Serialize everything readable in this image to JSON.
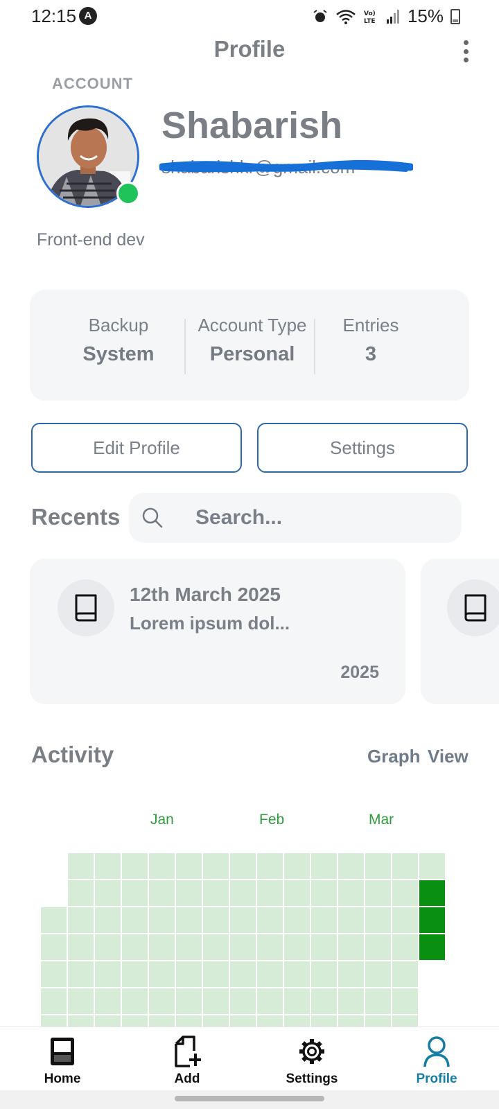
{
  "status_bar": {
    "time": "12:15",
    "app_icon": "A",
    "battery": "15%"
  },
  "header": {
    "title": "Profile",
    "menu_icon": "kebab-menu-icon"
  },
  "account": {
    "section_label": "ACCOUNT",
    "name": "Shabarish",
    "email": "shabarishkr@gmail.com",
    "email_redacted": true,
    "role": "Front-end  dev",
    "online": true
  },
  "stats": [
    {
      "label": "Backup",
      "value": "System"
    },
    {
      "label": "Account Type",
      "value": "Personal"
    },
    {
      "label": "Entries",
      "value": "3"
    }
  ],
  "actions": {
    "edit_profile": "Edit Profile",
    "settings": "Settings"
  },
  "recents": {
    "title": "Recents",
    "search_placeholder": "Search...",
    "items": [
      {
        "date": "12th March 2025",
        "snippet": "Lorem ipsum dol...",
        "year": "2025",
        "icon": "book-icon"
      },
      {
        "date": "",
        "snippet": "",
        "year": "",
        "icon": "book-icon"
      }
    ]
  },
  "activity": {
    "title": "Activity",
    "graph_label": "Graph",
    "view_label": "View",
    "months": [
      "Jan",
      "Feb",
      "Mar"
    ],
    "colors": {
      "empty": "#d7ecd6",
      "active": "#0a9010"
    },
    "active_entries": 3
  },
  "bottom_nav": [
    {
      "label": "Home",
      "icon": "home-icon",
      "active": false
    },
    {
      "label": "Add",
      "icon": "add-file-icon",
      "active": false
    },
    {
      "label": "Settings",
      "icon": "gear-icon",
      "active": false
    },
    {
      "label": "Profile",
      "icon": "person-icon",
      "active": true
    }
  ],
  "colors": {
    "accent": "#157ca3",
    "outline": "#2f66a5",
    "avatar_ring": "#2d6fd0",
    "online": "#1fc35a"
  }
}
